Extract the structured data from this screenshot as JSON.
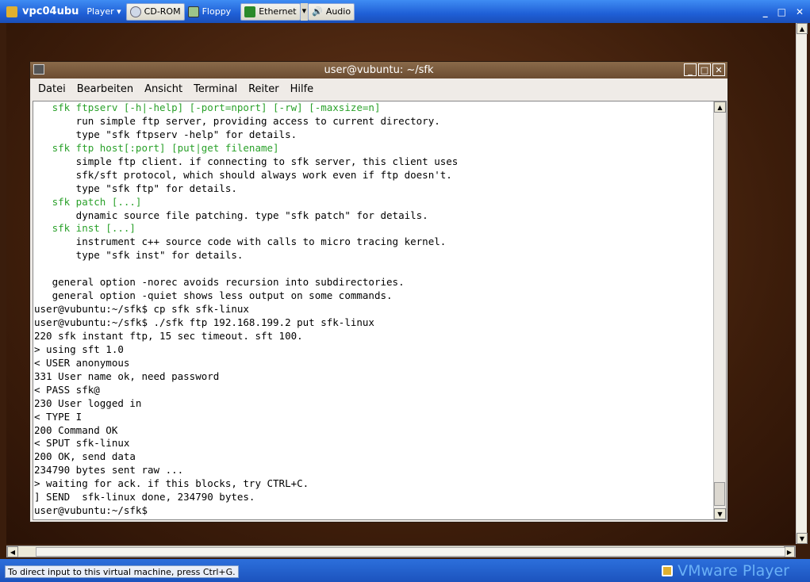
{
  "player": {
    "vm_name": "vpc04ubu",
    "menu": "Player",
    "devices": [
      {
        "label": "CD-ROM",
        "icon": "cdrom-icon"
      },
      {
        "label": "Floppy",
        "icon": "floppy-icon"
      },
      {
        "label": "Ethernet",
        "icon": "ethernet-icon"
      },
      {
        "label": "Audio",
        "icon": "audio-icon"
      }
    ],
    "status": "To direct input to this virtual machine, press Ctrl+G.",
    "brand": "VMware Player"
  },
  "terminal": {
    "title": "user@vubuntu: ~/sfk",
    "menu": [
      "Datei",
      "Bearbeiten",
      "Ansicht",
      "Terminal",
      "Reiter",
      "Hilfe"
    ],
    "lines": [
      {
        "t": "   sfk ftpserv [-h|-help] [-port=nport] [-rw] [-maxsize=n]",
        "green": true
      },
      {
        "t": "       run simple ftp server, providing access to current directory."
      },
      {
        "t": "       type \"sfk ftpserv -help\" for details."
      },
      {
        "t": "   sfk ftp host[:port] [put|get filename]",
        "green": true
      },
      {
        "t": "       simple ftp client. if connecting to sfk server, this client uses"
      },
      {
        "t": "       sfk/sft protocol, which should always work even if ftp doesn't."
      },
      {
        "t": "       type \"sfk ftp\" for details."
      },
      {
        "t": "   sfk patch [...]",
        "green": true
      },
      {
        "t": "       dynamic source file patching. type \"sfk patch\" for details."
      },
      {
        "t": "   sfk inst [...]",
        "green": true
      },
      {
        "t": "       instrument c++ source code with calls to micro tracing kernel."
      },
      {
        "t": "       type \"sfk inst\" for details."
      },
      {
        "t": ""
      },
      {
        "t": "   general option -norec avoids recursion into subdirectories."
      },
      {
        "t": "   general option -quiet shows less output on some commands."
      },
      {
        "t": "user@vubuntu:~/sfk$ cp sfk sfk-linux"
      },
      {
        "t": "user@vubuntu:~/sfk$ ./sfk ftp 192.168.199.2 put sfk-linux"
      },
      {
        "t": "220 sfk instant ftp, 15 sec timeout. sft 100."
      },
      {
        "t": "> using sft 1.0"
      },
      {
        "t": "< USER anonymous"
      },
      {
        "t": "331 User name ok, need password"
      },
      {
        "t": "< PASS sfk@"
      },
      {
        "t": "230 User logged in"
      },
      {
        "t": "< TYPE I"
      },
      {
        "t": "200 Command OK"
      },
      {
        "t": "< SPUT sfk-linux"
      },
      {
        "t": "200 OK, send data"
      },
      {
        "t": "234790 bytes sent raw ..."
      },
      {
        "t": "> waiting for ack. if this blocks, try CTRL+C."
      },
      {
        "t": "] SEND  sfk-linux done, 234790 bytes."
      },
      {
        "t": "user@vubuntu:~/sfk$ "
      }
    ]
  }
}
